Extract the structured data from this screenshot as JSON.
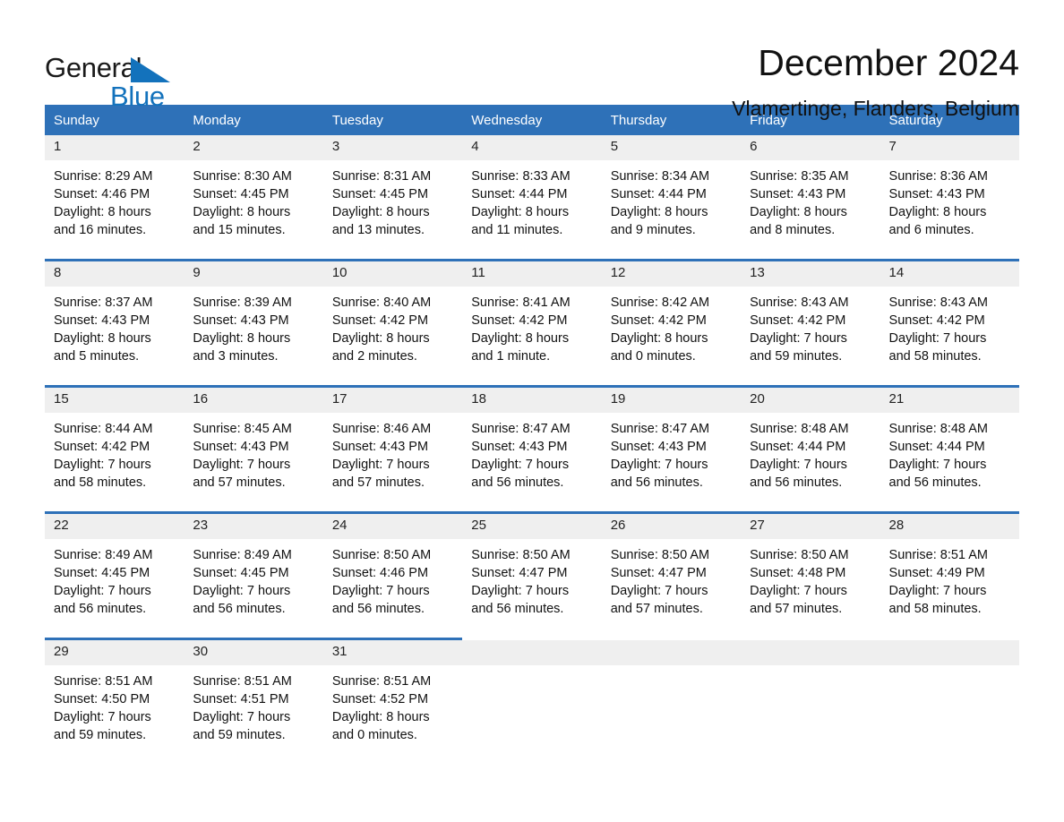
{
  "brand": {
    "name_part1": "General",
    "name_part2": "Blue"
  },
  "header": {
    "title": "December 2024",
    "location": "Vlamertinge, Flanders, Belgium"
  },
  "calendar": {
    "weekday_headers": [
      "Sunday",
      "Monday",
      "Tuesday",
      "Wednesday",
      "Thursday",
      "Friday",
      "Saturday"
    ],
    "colors": {
      "header_background": "#2E71B8",
      "header_text": "#FFFFFF",
      "daynum_background": "#EFEFEF",
      "row_divider": "#2E71B8",
      "brand_blue": "#1372BC"
    },
    "weeks": [
      [
        {
          "day": "1",
          "sunrise": "Sunrise: 8:29 AM",
          "sunset": "Sunset: 4:46 PM",
          "daylight_line1": "Daylight: 8 hours",
          "daylight_line2": "and 16 minutes."
        },
        {
          "day": "2",
          "sunrise": "Sunrise: 8:30 AM",
          "sunset": "Sunset: 4:45 PM",
          "daylight_line1": "Daylight: 8 hours",
          "daylight_line2": "and 15 minutes."
        },
        {
          "day": "3",
          "sunrise": "Sunrise: 8:31 AM",
          "sunset": "Sunset: 4:45 PM",
          "daylight_line1": "Daylight: 8 hours",
          "daylight_line2": "and 13 minutes."
        },
        {
          "day": "4",
          "sunrise": "Sunrise: 8:33 AM",
          "sunset": "Sunset: 4:44 PM",
          "daylight_line1": "Daylight: 8 hours",
          "daylight_line2": "and 11 minutes."
        },
        {
          "day": "5",
          "sunrise": "Sunrise: 8:34 AM",
          "sunset": "Sunset: 4:44 PM",
          "daylight_line1": "Daylight: 8 hours",
          "daylight_line2": "and 9 minutes."
        },
        {
          "day": "6",
          "sunrise": "Sunrise: 8:35 AM",
          "sunset": "Sunset: 4:43 PM",
          "daylight_line1": "Daylight: 8 hours",
          "daylight_line2": "and 8 minutes."
        },
        {
          "day": "7",
          "sunrise": "Sunrise: 8:36 AM",
          "sunset": "Sunset: 4:43 PM",
          "daylight_line1": "Daylight: 8 hours",
          "daylight_line2": "and 6 minutes."
        }
      ],
      [
        {
          "day": "8",
          "sunrise": "Sunrise: 8:37 AM",
          "sunset": "Sunset: 4:43 PM",
          "daylight_line1": "Daylight: 8 hours",
          "daylight_line2": "and 5 minutes."
        },
        {
          "day": "9",
          "sunrise": "Sunrise: 8:39 AM",
          "sunset": "Sunset: 4:43 PM",
          "daylight_line1": "Daylight: 8 hours",
          "daylight_line2": "and 3 minutes."
        },
        {
          "day": "10",
          "sunrise": "Sunrise: 8:40 AM",
          "sunset": "Sunset: 4:42 PM",
          "daylight_line1": "Daylight: 8 hours",
          "daylight_line2": "and 2 minutes."
        },
        {
          "day": "11",
          "sunrise": "Sunrise: 8:41 AM",
          "sunset": "Sunset: 4:42 PM",
          "daylight_line1": "Daylight: 8 hours",
          "daylight_line2": "and 1 minute."
        },
        {
          "day": "12",
          "sunrise": "Sunrise: 8:42 AM",
          "sunset": "Sunset: 4:42 PM",
          "daylight_line1": "Daylight: 8 hours",
          "daylight_line2": "and 0 minutes."
        },
        {
          "day": "13",
          "sunrise": "Sunrise: 8:43 AM",
          "sunset": "Sunset: 4:42 PM",
          "daylight_line1": "Daylight: 7 hours",
          "daylight_line2": "and 59 minutes."
        },
        {
          "day": "14",
          "sunrise": "Sunrise: 8:43 AM",
          "sunset": "Sunset: 4:42 PM",
          "daylight_line1": "Daylight: 7 hours",
          "daylight_line2": "and 58 minutes."
        }
      ],
      [
        {
          "day": "15",
          "sunrise": "Sunrise: 8:44 AM",
          "sunset": "Sunset: 4:42 PM",
          "daylight_line1": "Daylight: 7 hours",
          "daylight_line2": "and 58 minutes."
        },
        {
          "day": "16",
          "sunrise": "Sunrise: 8:45 AM",
          "sunset": "Sunset: 4:43 PM",
          "daylight_line1": "Daylight: 7 hours",
          "daylight_line2": "and 57 minutes."
        },
        {
          "day": "17",
          "sunrise": "Sunrise: 8:46 AM",
          "sunset": "Sunset: 4:43 PM",
          "daylight_line1": "Daylight: 7 hours",
          "daylight_line2": "and 57 minutes."
        },
        {
          "day": "18",
          "sunrise": "Sunrise: 8:47 AM",
          "sunset": "Sunset: 4:43 PM",
          "daylight_line1": "Daylight: 7 hours",
          "daylight_line2": "and 56 minutes."
        },
        {
          "day": "19",
          "sunrise": "Sunrise: 8:47 AM",
          "sunset": "Sunset: 4:43 PM",
          "daylight_line1": "Daylight: 7 hours",
          "daylight_line2": "and 56 minutes."
        },
        {
          "day": "20",
          "sunrise": "Sunrise: 8:48 AM",
          "sunset": "Sunset: 4:44 PM",
          "daylight_line1": "Daylight: 7 hours",
          "daylight_line2": "and 56 minutes."
        },
        {
          "day": "21",
          "sunrise": "Sunrise: 8:48 AM",
          "sunset": "Sunset: 4:44 PM",
          "daylight_line1": "Daylight: 7 hours",
          "daylight_line2": "and 56 minutes."
        }
      ],
      [
        {
          "day": "22",
          "sunrise": "Sunrise: 8:49 AM",
          "sunset": "Sunset: 4:45 PM",
          "daylight_line1": "Daylight: 7 hours",
          "daylight_line2": "and 56 minutes."
        },
        {
          "day": "23",
          "sunrise": "Sunrise: 8:49 AM",
          "sunset": "Sunset: 4:45 PM",
          "daylight_line1": "Daylight: 7 hours",
          "daylight_line2": "and 56 minutes."
        },
        {
          "day": "24",
          "sunrise": "Sunrise: 8:50 AM",
          "sunset": "Sunset: 4:46 PM",
          "daylight_line1": "Daylight: 7 hours",
          "daylight_line2": "and 56 minutes."
        },
        {
          "day": "25",
          "sunrise": "Sunrise: 8:50 AM",
          "sunset": "Sunset: 4:47 PM",
          "daylight_line1": "Daylight: 7 hours",
          "daylight_line2": "and 56 minutes."
        },
        {
          "day": "26",
          "sunrise": "Sunrise: 8:50 AM",
          "sunset": "Sunset: 4:47 PM",
          "daylight_line1": "Daylight: 7 hours",
          "daylight_line2": "and 57 minutes."
        },
        {
          "day": "27",
          "sunrise": "Sunrise: 8:50 AM",
          "sunset": "Sunset: 4:48 PM",
          "daylight_line1": "Daylight: 7 hours",
          "daylight_line2": "and 57 minutes."
        },
        {
          "day": "28",
          "sunrise": "Sunrise: 8:51 AM",
          "sunset": "Sunset: 4:49 PM",
          "daylight_line1": "Daylight: 7 hours",
          "daylight_line2": "and 58 minutes."
        }
      ],
      [
        {
          "day": "29",
          "sunrise": "Sunrise: 8:51 AM",
          "sunset": "Sunset: 4:50 PM",
          "daylight_line1": "Daylight: 7 hours",
          "daylight_line2": "and 59 minutes."
        },
        {
          "day": "30",
          "sunrise": "Sunrise: 8:51 AM",
          "sunset": "Sunset: 4:51 PM",
          "daylight_line1": "Daylight: 7 hours",
          "daylight_line2": "and 59 minutes."
        },
        {
          "day": "31",
          "sunrise": "Sunrise: 8:51 AM",
          "sunset": "Sunset: 4:52 PM",
          "daylight_line1": "Daylight: 8 hours",
          "daylight_line2": "and 0 minutes."
        },
        {
          "day": "",
          "sunrise": "",
          "sunset": "",
          "daylight_line1": "",
          "daylight_line2": ""
        },
        {
          "day": "",
          "sunrise": "",
          "sunset": "",
          "daylight_line1": "",
          "daylight_line2": ""
        },
        {
          "day": "",
          "sunrise": "",
          "sunset": "",
          "daylight_line1": "",
          "daylight_line2": ""
        },
        {
          "day": "",
          "sunrise": "",
          "sunset": "",
          "daylight_line1": "",
          "daylight_line2": ""
        }
      ]
    ]
  }
}
